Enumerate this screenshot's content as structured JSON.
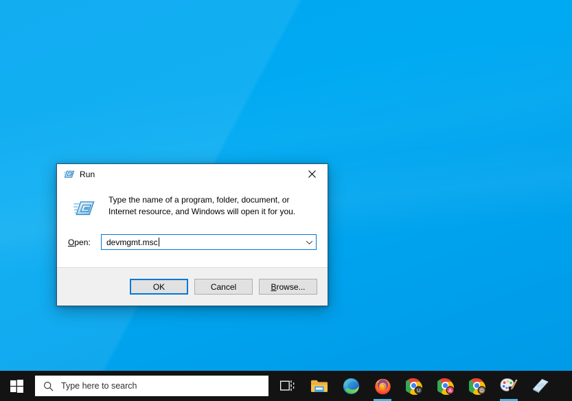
{
  "desktop": {
    "background_color": "#00a6f0",
    "name": "windows-desktop"
  },
  "dialog": {
    "title": "Run",
    "title_icon": "run-icon",
    "close_icon": "close-icon",
    "description": "Type the name of a program, folder, document, or Internet resource, and Windows will open it for you.",
    "body_icon": "run-icon-large",
    "open_label_prefix": "",
    "open_label_accel": "O",
    "open_label_suffix": "pen:",
    "open_label_full": "Open:",
    "input_value": "devmgmt.msc",
    "input_placeholder": "",
    "dropdown_icon": "chevron-down-icon",
    "buttons": {
      "ok": "OK",
      "cancel": "Cancel",
      "browse_accel": "B",
      "browse_rest": "rowse...",
      "browse_full": "Browse..."
    },
    "accent_color": "#0078d7",
    "footer_color": "#f0f0f0",
    "body_color": "#ffffff"
  },
  "taskbar": {
    "background_color": "#131313",
    "start_label": "Start",
    "start_icon": "windows-logo-icon",
    "search": {
      "placeholder": "Type here to search",
      "icon": "search-icon"
    },
    "items": [
      {
        "name": "task-view",
        "label": "Task View",
        "icon": "task-view-icon"
      },
      {
        "name": "file-explorer",
        "label": "File Explorer",
        "icon": "folder-icon"
      },
      {
        "name": "microsoft-edge",
        "label": "Microsoft Edge",
        "icon": "edge-icon"
      },
      {
        "name": "firefox",
        "label": "Firefox",
        "icon": "firefox-icon",
        "active": true
      },
      {
        "name": "chrome-profile-u",
        "label": "Google Chrome",
        "icon": "chrome-icon",
        "badge": "U",
        "badge_color": "#3c4043"
      },
      {
        "name": "chrome-profile-a",
        "label": "Google Chrome",
        "icon": "chrome-icon",
        "badge": "A",
        "badge_color": "#e8467c"
      },
      {
        "name": "chrome-profile-d",
        "label": "Google Chrome",
        "icon": "chrome-icon",
        "badge": "D",
        "badge_color": "#8d7762"
      },
      {
        "name": "paint",
        "label": "Paint",
        "icon": "paint-palette-icon",
        "active": true
      },
      {
        "name": "sticky-notes",
        "label": "Sticky Notes",
        "icon": "sticky-notes-icon"
      }
    ]
  }
}
